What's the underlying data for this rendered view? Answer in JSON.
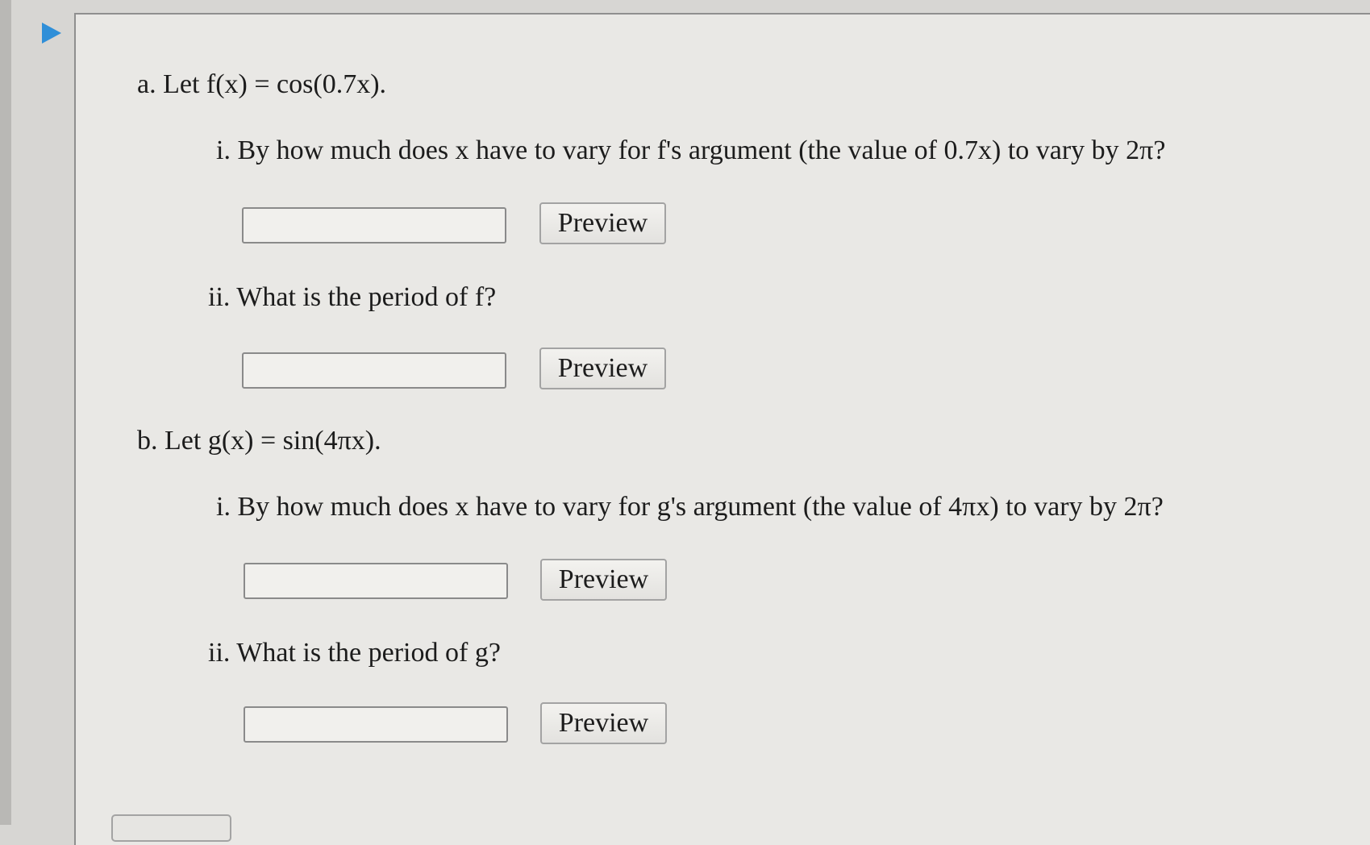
{
  "part_a": {
    "label": "a.",
    "intro": "Let",
    "function_def": "f(x) = cos(0.7x).",
    "q1_label": "i.",
    "q1_text": "By how much does x have to vary for f's argument (the value of 0.7x) to vary by 2π?",
    "q1_value": "",
    "q2_label": "ii.",
    "q2_text": "What is the period of f?",
    "q2_value": ""
  },
  "part_b": {
    "label": "b.",
    "intro": "Let",
    "function_def": "g(x) = sin(4πx).",
    "q1_label": "i.",
    "q1_text": "By how much does x have to vary for g's argument (the value of 4πx) to vary by 2π?",
    "q1_value": "",
    "q2_label": "ii.",
    "q2_text": "What is the period of g?",
    "q2_value": ""
  },
  "buttons": {
    "preview_label": "Preview"
  },
  "icons": {
    "toggle": "triangle-right-icon"
  },
  "colors": {
    "toggle_icon": "#2f8fd8"
  }
}
